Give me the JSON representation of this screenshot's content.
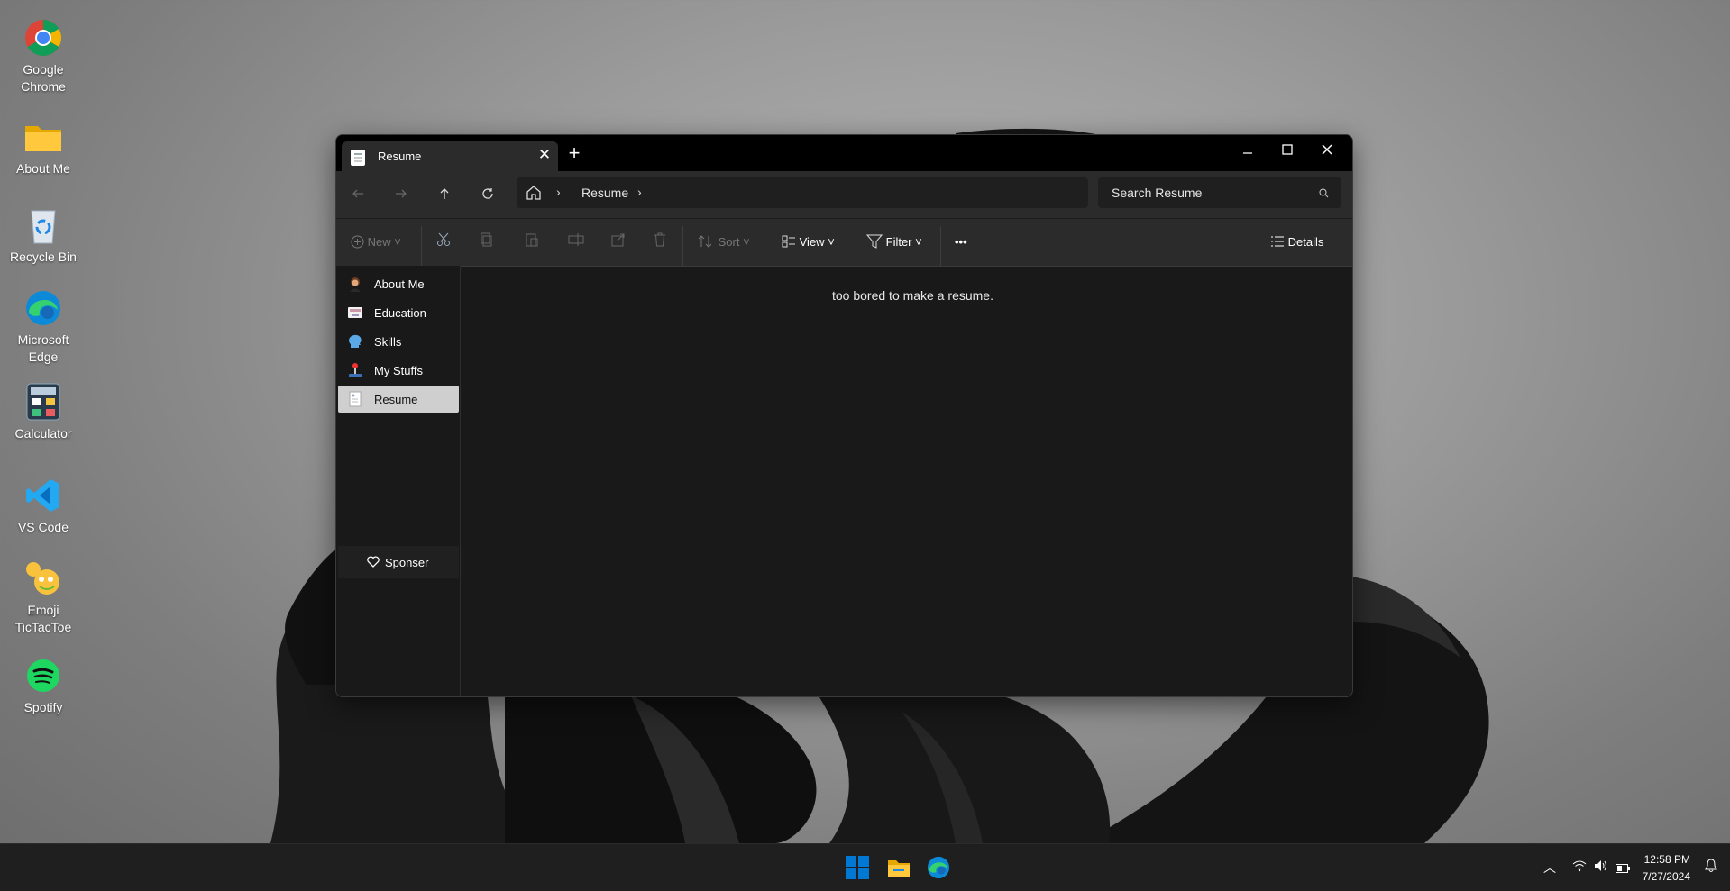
{
  "desktop": {
    "icons": [
      {
        "label": "Google Chrome",
        "icon": "chrome-icon"
      },
      {
        "label": "About Me",
        "icon": "folder-icon"
      },
      {
        "label": "Recycle Bin",
        "icon": "recycle-bin-icon"
      },
      {
        "label": "Microsoft Edge",
        "icon": "edge-icon"
      },
      {
        "label": "Calculator",
        "icon": "calculator-icon"
      },
      {
        "label": "VS Code",
        "icon": "vscode-icon"
      },
      {
        "label": "Emoji TicTacToe",
        "icon": "emoji-icon"
      },
      {
        "label": "Spotify",
        "icon": "spotify-icon"
      }
    ]
  },
  "window": {
    "tab_title": "Resume",
    "breadcrumb": {
      "current": "Resume"
    },
    "search_placeholder": "Search Resume",
    "commands": {
      "new": "New",
      "sort": "Sort",
      "view": "View",
      "filter": "Filter",
      "more": "•••",
      "details": "Details"
    },
    "sidebar": {
      "items": [
        {
          "label": "About Me",
          "icon": "avatar-icon"
        },
        {
          "label": "Education",
          "icon": "education-icon"
        },
        {
          "label": "Skills",
          "icon": "brain-icon"
        },
        {
          "label": "My Stuffs",
          "icon": "joystick-icon"
        },
        {
          "label": "Resume",
          "icon": "document-icon",
          "active": true
        }
      ],
      "sponsor_label": "Sponser"
    },
    "content": {
      "message": "too bored to make a resume."
    }
  },
  "taskbar": {
    "time": "12:58 PM",
    "date": "7/27/2024"
  },
  "colors": {
    "accent": "#0078d4",
    "window_bg": "#191919",
    "toolbar_bg": "#2b2b2b"
  }
}
